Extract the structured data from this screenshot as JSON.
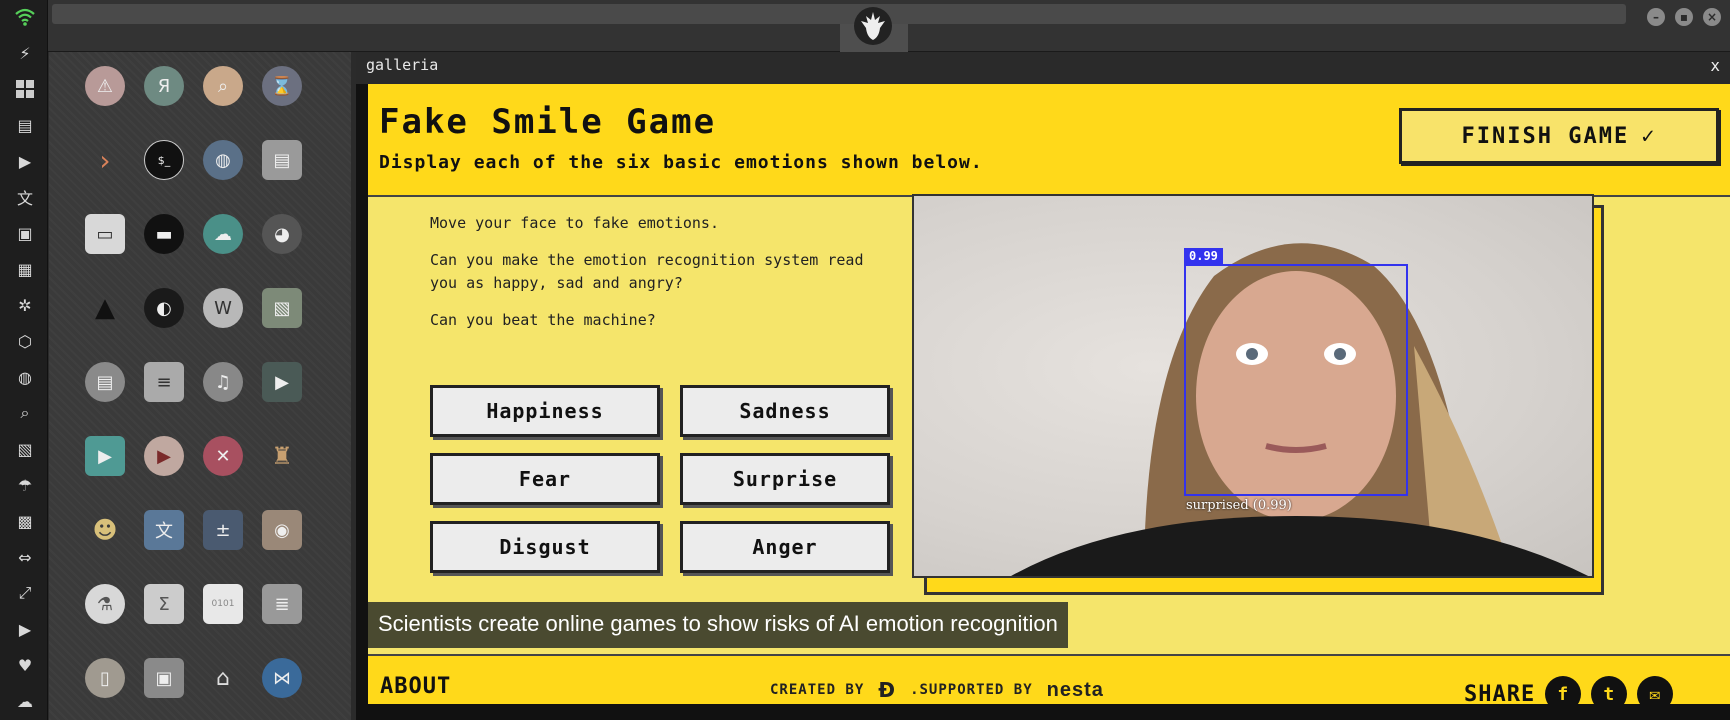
{
  "window": {
    "title": "galleria",
    "close_label": "x"
  },
  "topbar": {
    "minimize_label": "–",
    "maximize_label": "▪",
    "close_label": "×"
  },
  "game": {
    "title": "Fake Smile Game",
    "subtitle": "Display each of the six basic emotions shown below.",
    "finish_label": "FINISH GAME",
    "finish_check": "✓",
    "instructions": [
      "Move your face to fake emotions.",
      "Can you make the emotion recognition system read you as happy, sad and angry?",
      "Can you beat the machine?"
    ],
    "emotions": [
      "Happiness",
      "Sadness",
      "Fear",
      "Surprise",
      "Disgust",
      "Anger"
    ],
    "detection": {
      "score": "0.99",
      "label": "surprised (0.99)"
    }
  },
  "caption": "Scientists create online games to show risks of AI emotion recognition",
  "footer": {
    "about": "ABOUT",
    "created_by": "CREATED BY",
    "supported_by": ".SUPPORTED BY",
    "sponsor": "nesta",
    "share": "SHARE",
    "share_icons": [
      "f",
      "t",
      "✉"
    ]
  },
  "colors": {
    "accent": "#ffd91a",
    "panel": "#f5e56b",
    "box": "#3333ee"
  },
  "dock_icons": [
    "wifi-icon",
    "bolt-icon",
    "windows-icon",
    "archive-icon",
    "play-icon",
    "translate-icon",
    "image-icon",
    "news-icon",
    "empire-icon",
    "hexagon-icon",
    "globe-icon",
    "search-icon",
    "map-icon",
    "umbrella-icon",
    "contact-icon",
    "code-icon",
    "expand-icon",
    "youtube-icon",
    "heart-icon",
    "cloud-icon"
  ]
}
